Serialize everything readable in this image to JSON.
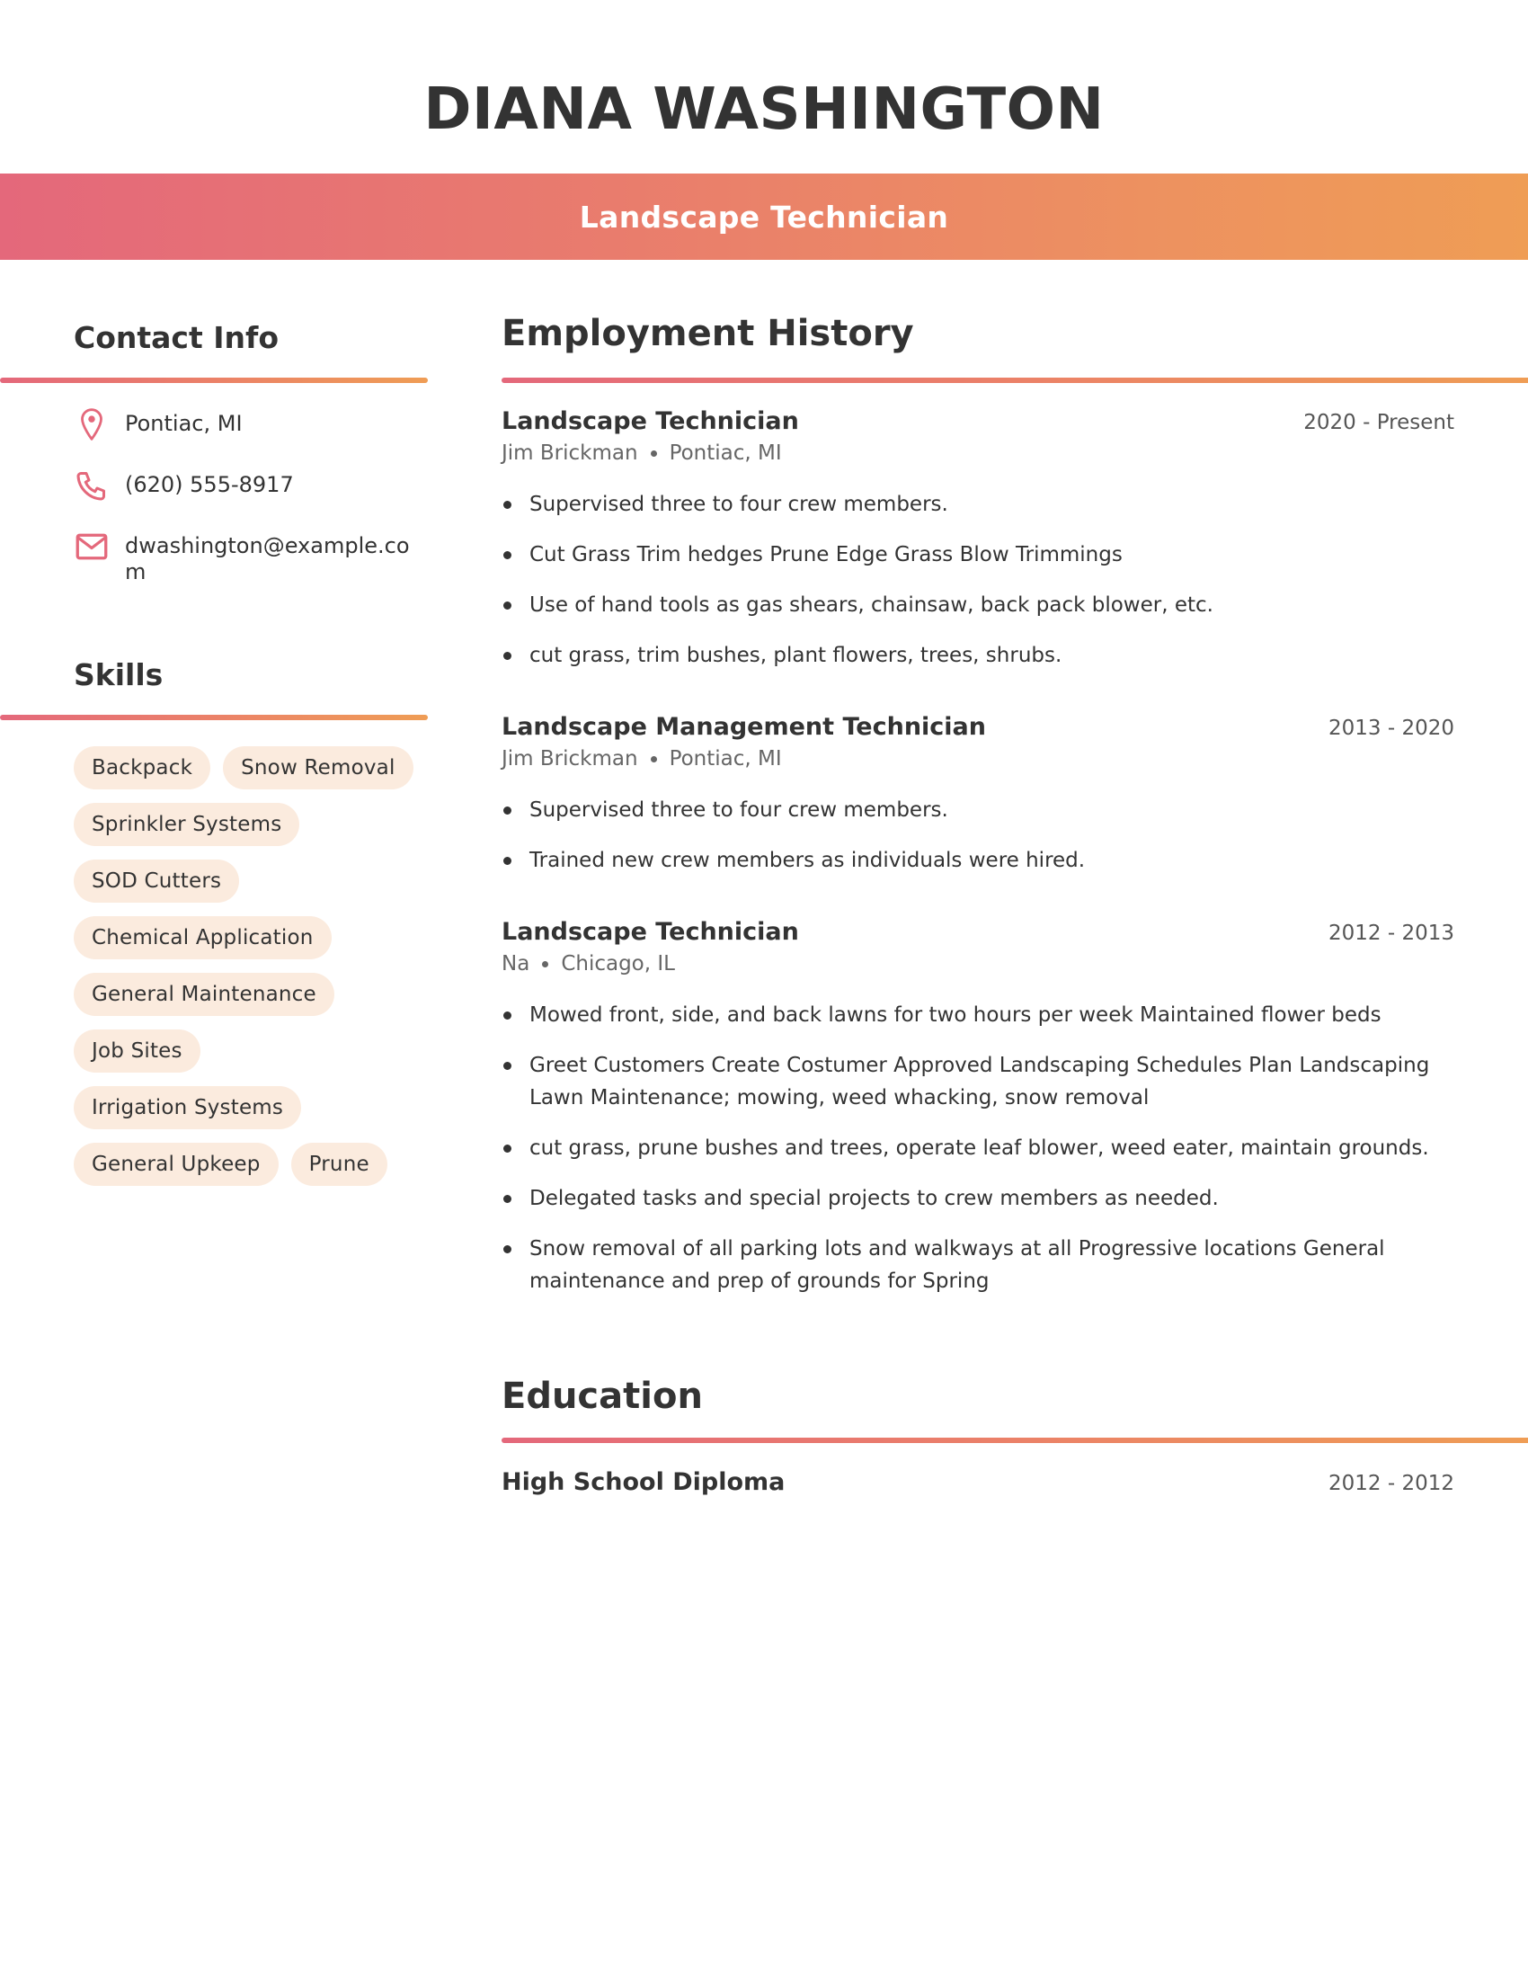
{
  "header": {
    "name": "DIANA WASHINGTON",
    "job_title": "Landscape Technician",
    "accent_colors": {
      "gradient_start": "#E4687B",
      "gradient_end": "#EF9D55",
      "chip_bg": "#FBEBDE"
    }
  },
  "contact": {
    "heading": "Contact Info",
    "items": [
      {
        "icon": "map-pin-icon",
        "text": "Pontiac, MI"
      },
      {
        "icon": "phone-icon",
        "text": "(620) 555-8917"
      },
      {
        "icon": "mail-icon",
        "text": "dwashington@example.com"
      }
    ]
  },
  "skills": {
    "heading": "Skills",
    "items": [
      "Backpack",
      "Snow Removal",
      "Sprinkler Systems",
      "SOD Cutters",
      "Chemical Application",
      "General Maintenance",
      "Job Sites",
      "Irrigation Systems",
      "General Upkeep",
      "Prune"
    ]
  },
  "employment": {
    "heading": "Employment History",
    "jobs": [
      {
        "title": "Landscape Technician",
        "dates": "2020 - Present",
        "employer": "Jim Brickman",
        "location": "Pontiac, MI",
        "bullets": [
          "Supervised three to four crew members.",
          "Cut Grass Trim hedges Prune Edge Grass Blow Trimmings",
          "Use of hand tools as gas shears, chainsaw, back pack blower, etc.",
          "cut grass, trim bushes, plant flowers, trees, shrubs."
        ]
      },
      {
        "title": "Landscape Management Technician",
        "dates": "2013 - 2020",
        "employer": "Jim Brickman",
        "location": "Pontiac, MI",
        "bullets": [
          "Supervised three to four crew members.",
          "Trained new crew members as individuals were hired."
        ]
      },
      {
        "title": "Landscape Technician",
        "dates": "2012 - 2013",
        "employer": "Na",
        "location": "Chicago, IL",
        "bullets": [
          "Mowed front, side, and back lawns for two hours per week Maintained flower beds",
          "Greet Customers Create Costumer Approved Landscaping Schedules Plan Landscaping Lawn Maintenance; mowing, weed whacking, snow removal",
          "cut grass, prune bushes and trees, operate leaf blower, weed eater, maintain grounds.",
          "Delegated tasks and special projects to crew members as needed.",
          "Snow removal of all parking lots and walkways at all Progressive locations General maintenance and prep of grounds for Spring"
        ]
      }
    ]
  },
  "education": {
    "heading": "Education",
    "items": [
      {
        "degree": "High School Diploma",
        "dates": "2012 - 2012"
      }
    ]
  }
}
